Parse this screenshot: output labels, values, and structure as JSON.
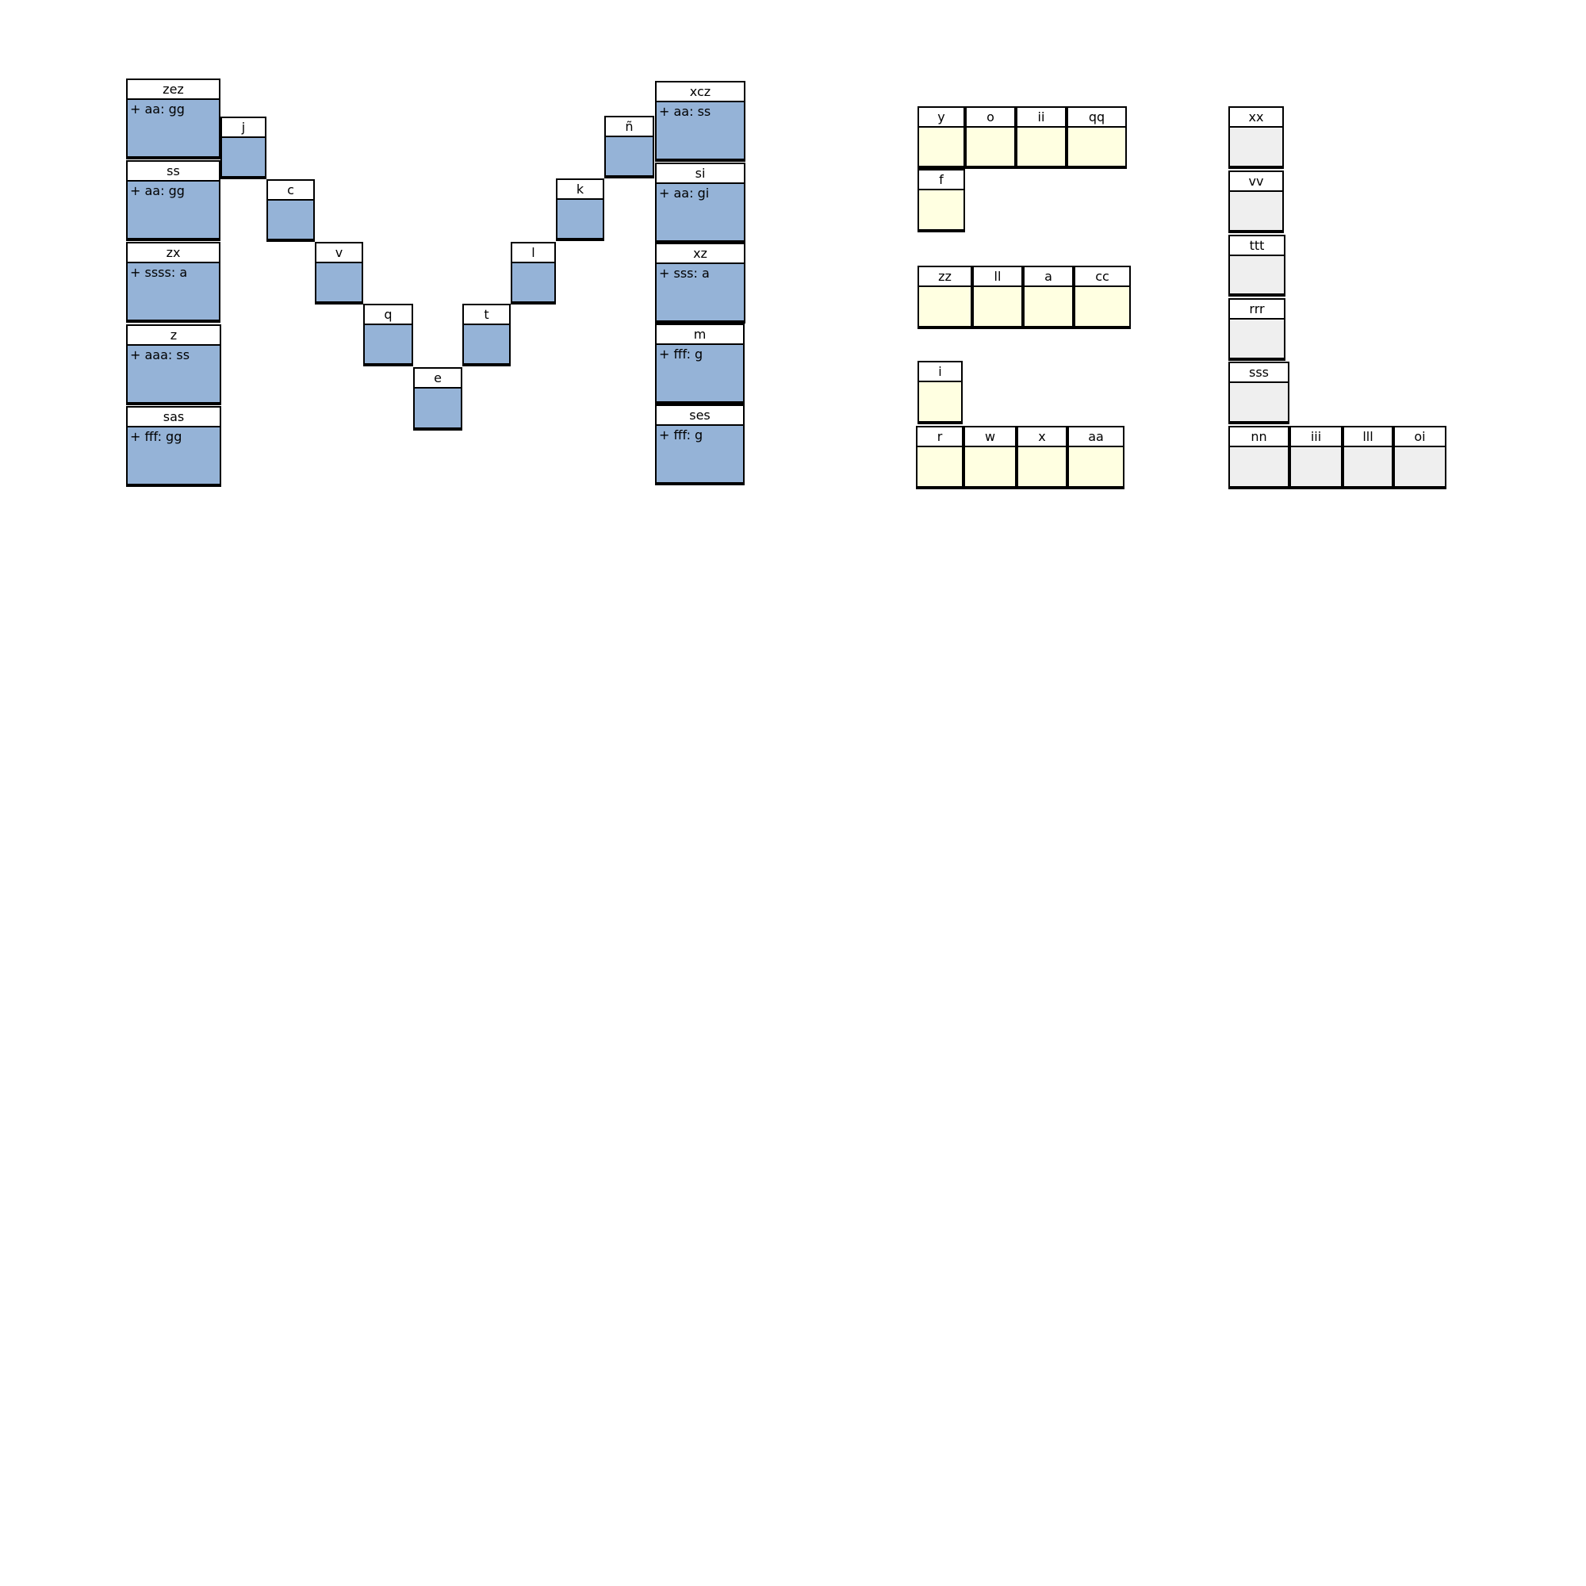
{
  "colors": {
    "blue": "#95b3d7",
    "yellow": "#ffffe1",
    "gray": "#efefef",
    "border": "#000000"
  },
  "m_group": [
    {
      "name": "zez",
      "attr": "+ aa: gg"
    },
    {
      "name": "ss",
      "attr": "+ aa: gg"
    },
    {
      "name": "zx",
      "attr": "+ ssss: a"
    },
    {
      "name": "z",
      "attr": "+ aaa: ss"
    },
    {
      "name": "sas",
      "attr": "+ fff: gg"
    },
    {
      "name": "j"
    },
    {
      "name": "c"
    },
    {
      "name": "v"
    },
    {
      "name": "q"
    },
    {
      "name": "e"
    },
    {
      "name": "t"
    },
    {
      "name": "l"
    },
    {
      "name": "k"
    },
    {
      "name": "ñ"
    },
    {
      "name": "xcz",
      "attr": "+ aa: ss"
    },
    {
      "name": "si",
      "attr": "+ aa: gi"
    },
    {
      "name": "xz",
      "attr": "+ sss: a"
    },
    {
      "name": "m",
      "attr": "+ fff: g"
    },
    {
      "name": "ses",
      "attr": "+ fff: g"
    }
  ],
  "s_group": [
    {
      "name": "y"
    },
    {
      "name": "o"
    },
    {
      "name": "ii"
    },
    {
      "name": "qq"
    },
    {
      "name": "f"
    },
    {
      "name": "zz"
    },
    {
      "name": "ll"
    },
    {
      "name": "a"
    },
    {
      "name": "cc"
    },
    {
      "name": "i"
    },
    {
      "name": "r"
    },
    {
      "name": "w"
    },
    {
      "name": "x"
    },
    {
      "name": "aa"
    }
  ],
  "l_group": [
    {
      "name": "xx"
    },
    {
      "name": "vv"
    },
    {
      "name": "ttt"
    },
    {
      "name": "rrr"
    },
    {
      "name": "sss"
    },
    {
      "name": "nn"
    },
    {
      "name": "iii"
    },
    {
      "name": "lll"
    },
    {
      "name": "oi"
    }
  ]
}
